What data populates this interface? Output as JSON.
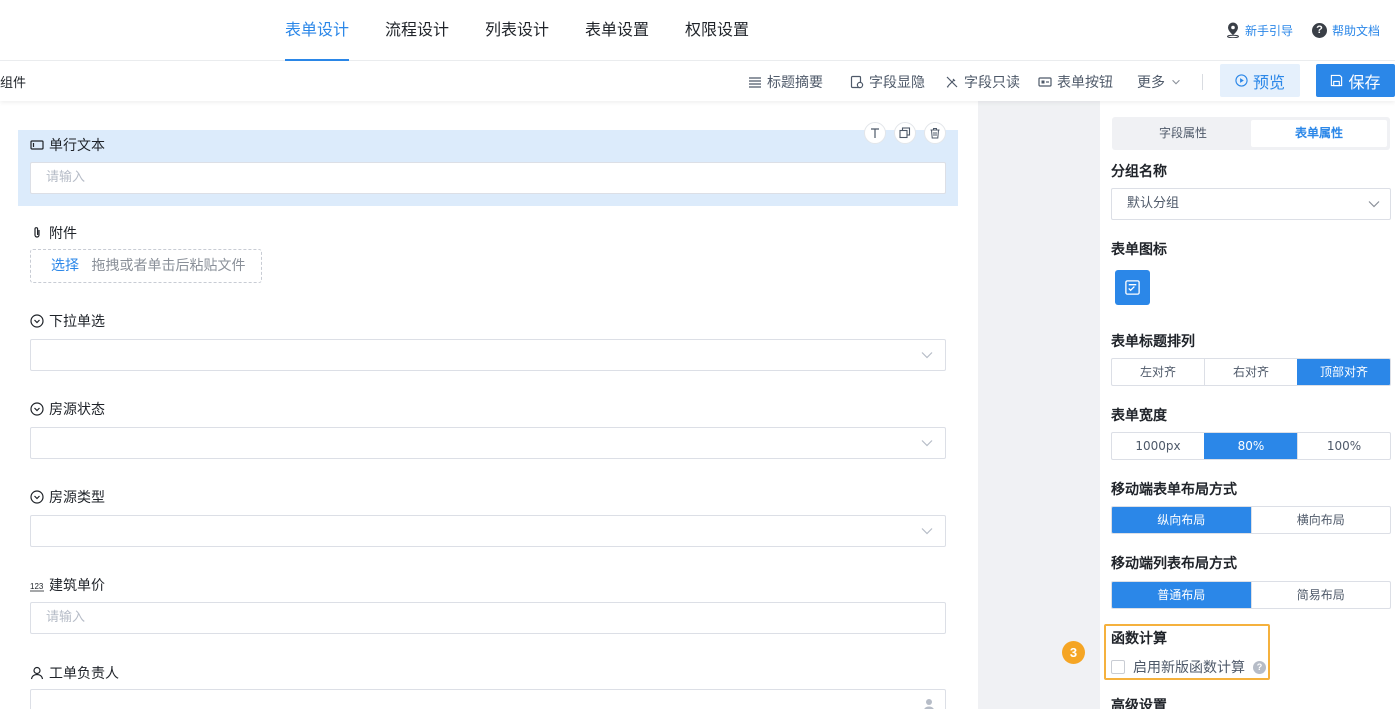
{
  "nav": {
    "tabs": [
      {
        "label": "表单设计",
        "active": true
      },
      {
        "label": "流程设计",
        "active": false
      },
      {
        "label": "列表设计",
        "active": false
      },
      {
        "label": "表单设置",
        "active": false
      },
      {
        "label": "权限设置",
        "active": false
      }
    ],
    "guide_label": "新手引导",
    "help_label": "帮助文档"
  },
  "toolbar": {
    "left_label": "组件",
    "items": [
      "标题摘要",
      "字段显隐",
      "字段只读",
      "表单按钮",
      "更多"
    ],
    "preview_label": "预览",
    "save_label": "保存"
  },
  "form": {
    "fields": [
      {
        "label": "单行文本",
        "type": "text",
        "placeholder": "请输入",
        "selected": true
      },
      {
        "label": "附件",
        "type": "upload",
        "pick_label": "选择",
        "hint": "拖拽或者单击后粘贴文件"
      },
      {
        "label": "下拉单选",
        "type": "select"
      },
      {
        "label": "房源状态",
        "type": "select"
      },
      {
        "label": "房源类型",
        "type": "select"
      },
      {
        "label": "建筑单价",
        "type": "number",
        "placeholder": "请输入"
      },
      {
        "label": "工单负责人",
        "type": "user"
      }
    ]
  },
  "panel": {
    "tabs": [
      "字段属性",
      "表单属性"
    ],
    "active_tab": "表单属性",
    "group_name": {
      "title": "分组名称",
      "value": "默认分组"
    },
    "form_icon_title": "表单图标",
    "title_align": {
      "title": "表单标题排列",
      "options": [
        "左对齐",
        "右对齐",
        "顶部对齐"
      ],
      "selected": "顶部对齐"
    },
    "form_width": {
      "title": "表单宽度",
      "options": [
        "1000px",
        "80%",
        "100%"
      ],
      "selected": "80%"
    },
    "mobile_form_layout": {
      "title": "移动端表单布局方式",
      "options": [
        "纵向布局",
        "横向布局"
      ],
      "selected": "纵向布局"
    },
    "mobile_list_layout": {
      "title": "移动端列表布局方式",
      "options": [
        "普通布局",
        "简易布局"
      ],
      "selected": "普通布局"
    },
    "function_calc": {
      "title": "函数计算",
      "checkbox_label": "启用新版函数计算",
      "checked": false
    },
    "advanced_title": "高级设置"
  },
  "callout": {
    "number": "3"
  },
  "colors": {
    "accent": "#2b87e8",
    "highlight": "#f5b13d",
    "badge": "#f5a524"
  }
}
